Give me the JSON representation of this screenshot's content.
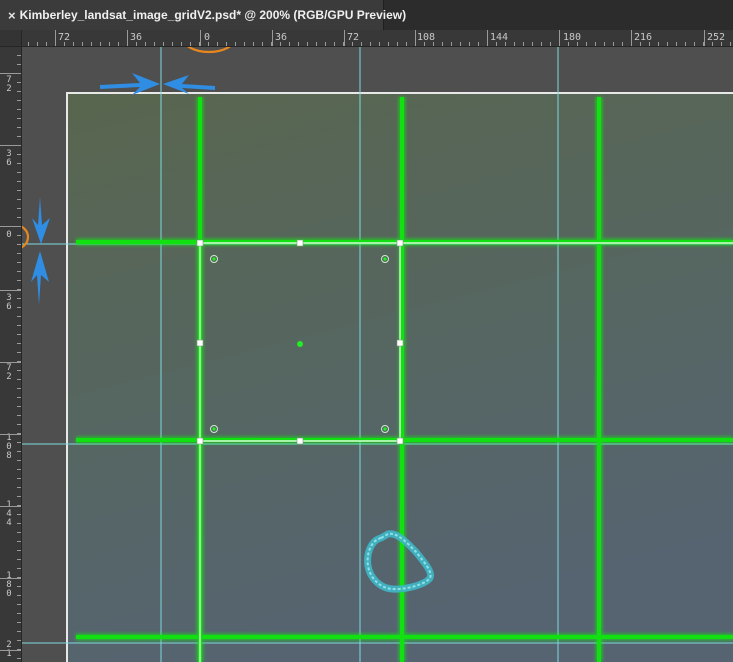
{
  "tab": {
    "close_glyph": "×",
    "title": "Kimberley_landsat_image_gridV2.psd* @ 200% (RGB/GPU Preview)"
  },
  "ruler": {
    "horizontal_labels": [
      "72",
      "36",
      "0",
      "36",
      "72",
      "108",
      "144",
      "180",
      "216",
      "252"
    ],
    "vertical_labels": [
      "7\n2",
      "3\n6",
      "0",
      "3\n6",
      "7\n2",
      "1\n0\n8",
      "1\n4\n4",
      "1\n8\n0",
      "2\n1"
    ]
  },
  "colors": {
    "grid_green": "#00e000",
    "guide_cyan": "#7fd8de",
    "annotation_blue": "#2f8de4",
    "annotation_orange": "#e8871e",
    "image_fill": "#5b6d5d",
    "pasteboard": "#4f4f4f"
  },
  "icons": {
    "tab_close": "close-icon",
    "arrows": "arrow-icon",
    "highlight": "orange-ellipse-highlight"
  }
}
